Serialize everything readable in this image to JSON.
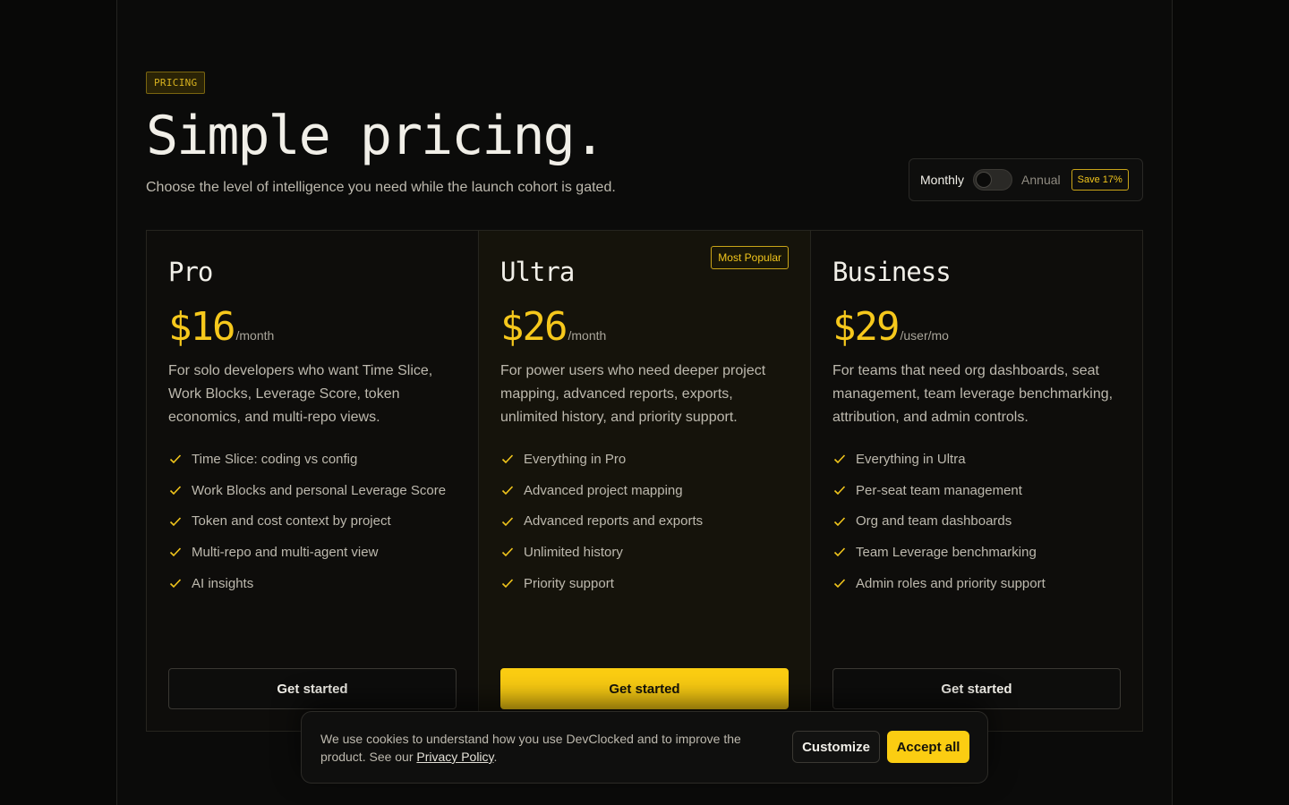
{
  "header": {
    "eyebrow": "PRICING",
    "title": "Simple pricing.",
    "subtitle": "Choose the level of intelligence you need while the launch cohort is gated."
  },
  "billing": {
    "monthly_label": "Monthly",
    "annual_label": "Annual",
    "annual_selected": false,
    "save_badge": "Save 17%"
  },
  "plans": [
    {
      "name": "Pro",
      "price": "$16",
      "period": "/month",
      "description": "For solo developers who want Time Slice, Work Blocks, Leverage Score, token economics, and multi-repo views.",
      "features": [
        "Time Slice: coding vs config",
        "Work Blocks and personal Leverage Score",
        "Token and cost context by project",
        "Multi-repo and multi-agent view",
        "AI insights"
      ],
      "cta": "Get started"
    },
    {
      "name": "Ultra",
      "badge": "Most Popular",
      "price": "$26",
      "period": "/month",
      "description": "For power users who need deeper project mapping, advanced reports, exports, unlimited history, and priority support.",
      "features": [
        "Everything in Pro",
        "Advanced project mapping",
        "Advanced reports and exports",
        "Unlimited history",
        "Priority support"
      ],
      "cta": "Get started"
    },
    {
      "name": "Business",
      "price": "$29",
      "period": "/user/mo",
      "description": "For teams that need org dashboards, seat management, team leverage benchmarking, attribution, and admin controls.",
      "features": [
        "Everything in Ultra",
        "Per-seat team management",
        "Org and team dashboards",
        "Team Leverage benchmarking",
        "Admin roles and priority support"
      ],
      "cta": "Get started"
    }
  ],
  "cookie": {
    "text": "We use cookies to understand how you use DevClocked and to improve the product. See our ",
    "link": "Privacy Policy",
    "end": ".",
    "customize": "Customize",
    "accept": "Accept all"
  },
  "colors": {
    "accent": "#fbcd12",
    "background": "#0b0b0a"
  },
  "icons": {
    "feature": "check-icon"
  }
}
